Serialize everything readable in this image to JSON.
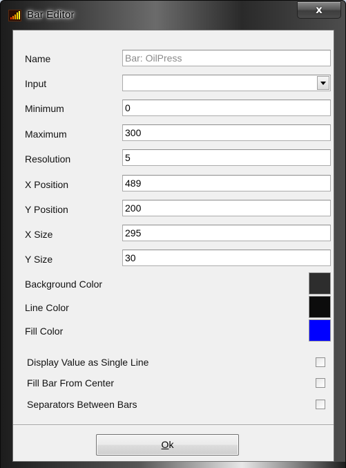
{
  "window": {
    "title": "Bar Editor",
    "close_label": "x",
    "icon": "bar-chart-icon"
  },
  "fields": {
    "name": {
      "label": "Name",
      "value": "Bar: OilPress"
    },
    "input": {
      "label": "Input",
      "value": ""
    },
    "minimum": {
      "label": "Minimum",
      "value": "0"
    },
    "maximum": {
      "label": "Maximum",
      "value": "300"
    },
    "resolution": {
      "label": "Resolution",
      "value": "5"
    },
    "x_position": {
      "label": "X Position",
      "value": "489"
    },
    "y_position": {
      "label": "Y Position",
      "value": "200"
    },
    "x_size": {
      "label": "X Size",
      "value": "295"
    },
    "y_size": {
      "label": "Y Size",
      "value": "30"
    }
  },
  "colors": {
    "background": {
      "label": "Background Color",
      "value": "#2d2d2d"
    },
    "line": {
      "label": "Line Color",
      "value": "#0c0c0c"
    },
    "fill": {
      "label": "Fill Color",
      "value": "#0000ff"
    }
  },
  "options": {
    "single_line": {
      "label": "Display Value as Single Line",
      "checked": false
    },
    "fill_center": {
      "label": "Fill Bar From Center",
      "checked": false
    },
    "separators": {
      "label": "Separators Between Bars",
      "checked": false
    }
  },
  "buttons": {
    "ok_mnemonic": "O",
    "ok_rest": "k"
  }
}
